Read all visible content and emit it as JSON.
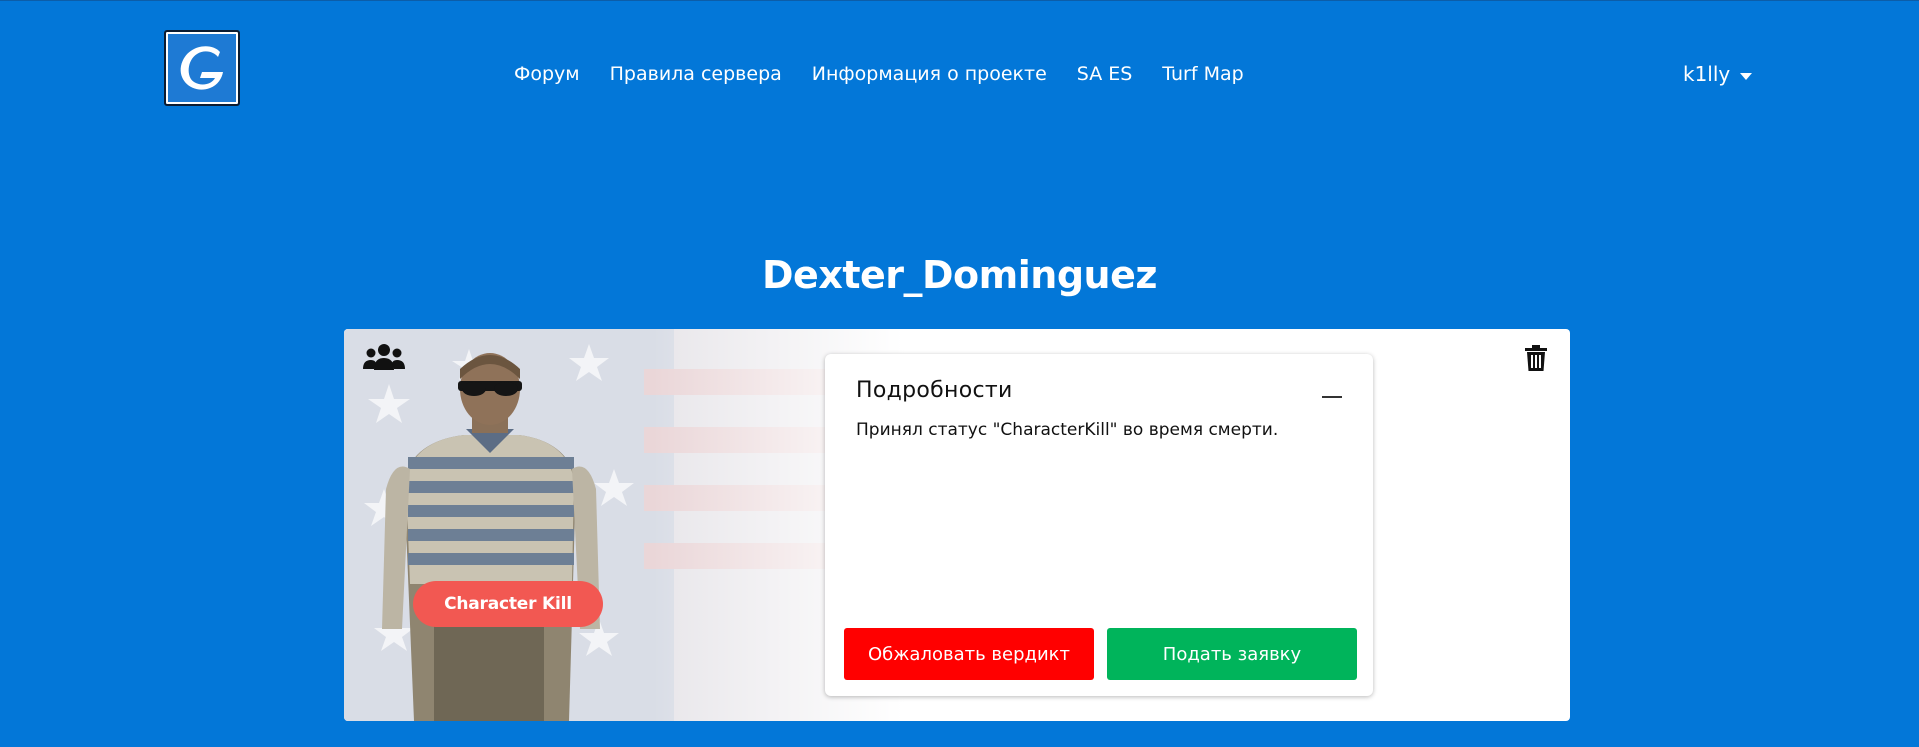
{
  "header": {
    "logo_icon": "g-logo",
    "nav": [
      {
        "label": "Форум"
      },
      {
        "label": "Правила сервера"
      },
      {
        "label": "Информация о проекте"
      },
      {
        "label": "SA ES"
      },
      {
        "label": "Turf Map"
      }
    ],
    "user": {
      "name": "k1lly",
      "icon": "chevron-down-icon"
    }
  },
  "page": {
    "title": "Dexter_Dominguez"
  },
  "card": {
    "icons": {
      "group": "group-icon",
      "delete": "trash-icon"
    },
    "badge": "Character Kill",
    "details": {
      "title": "Подробности",
      "text": "Принял статус \"CharacterKill\" во время смерти.",
      "appeal_button": "Обжаловать вердикт",
      "submit_button": "Подать заявку"
    }
  },
  "colors": {
    "background": "#0377d8",
    "appeal": "#ff0000",
    "submit": "#00b45b",
    "badge": "#f25852"
  }
}
